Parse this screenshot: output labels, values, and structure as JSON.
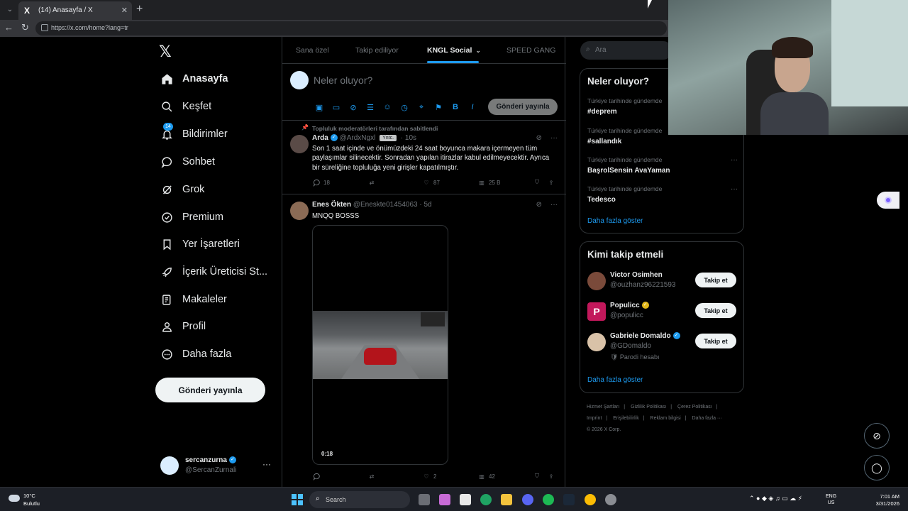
{
  "browser": {
    "tab_title": "(14) Anasayfa / X",
    "url": "https://x.com/home?lang=tr",
    "new_tab": "+",
    "close": "✕"
  },
  "nav": {
    "logo": "𝕏",
    "items": [
      {
        "label": "Anasayfa",
        "icon": "home-icon",
        "badge": ""
      },
      {
        "label": "Keşfet",
        "icon": "search-icon",
        "badge": ""
      },
      {
        "label": "Bildirimler",
        "icon": "bell-icon",
        "badge": "14"
      },
      {
        "label": "Sohbet",
        "icon": "chat-icon",
        "badge": ""
      },
      {
        "label": "Grok",
        "icon": "grok-icon",
        "badge": ""
      },
      {
        "label": "Premium",
        "icon": "premium-icon",
        "badge": ""
      },
      {
        "label": "Yer İşaretleri",
        "icon": "bookmark-icon",
        "badge": ""
      },
      {
        "label": "İçerik Üreticisi St...",
        "icon": "rocket-icon",
        "badge": ""
      },
      {
        "label": "Makaleler",
        "icon": "article-icon",
        "badge": ""
      },
      {
        "label": "Profil",
        "icon": "profile-icon",
        "badge": ""
      },
      {
        "label": "Daha fazla",
        "icon": "more-icon",
        "badge": ""
      }
    ],
    "post_button": "Gönderi yayınla",
    "profile": {
      "name": "sercanzurna",
      "handle": "@SercanZurnali",
      "more": "···"
    }
  },
  "timeline": {
    "tabs": [
      "Sana özel",
      "Takip ediliyor",
      "KNGL Social",
      "SPEED GANG"
    ],
    "active_tab": "KNGL Social",
    "compose_placeholder": "Neler oluyor?",
    "compose_post": "Gönderi yayınla",
    "posts": [
      {
        "pinned_label": "Topluluk moderatörleri tarafından sabitlendi",
        "name": "Arda",
        "handle": "@ArdxNgxl",
        "role": "Yntc.",
        "time": "· 10s",
        "text": "Son 1 saat içinde ve önümüzdeki 24 saat boyunca makara içermeyen tüm paylaşımlar silinecektir. Sonradan yapılan itirazlar kabul edilmeyecektir. Ayrıca bir süreliğine topluluğa yeni girişler kapatılmıştır.",
        "replies": "18",
        "reposts": "",
        "likes": "87",
        "views": "25 B"
      },
      {
        "name": "Enes Ökten",
        "handle": "@Eneskte01454063",
        "time": "· 5d",
        "text": "MNQQ BOSSS",
        "video_time": "0:18",
        "replies": "",
        "reposts": "",
        "likes": "2",
        "views": "42"
      }
    ]
  },
  "right": {
    "search_placeholder": "Ara",
    "trends_title": "Neler oluyor?",
    "trends": [
      {
        "context": "Türkiye tarihinde gündemde",
        "name": "#deprem"
      },
      {
        "context": "Türkiye tarihinde gündemde",
        "name": "#sallandık"
      },
      {
        "context": "Türkiye tarihinde gündemde",
        "name": "BaşrolSensin AvaYaman"
      },
      {
        "context": "Türkiye tarihinde gündemde",
        "name": "Tedesco"
      }
    ],
    "trends_more": "Daha fazla göster",
    "who_title": "Kimi takip etmeli",
    "who": [
      {
        "name": "Victor Osimhen",
        "handle": "@ouzhanz96221593",
        "extra": "",
        "verified": "",
        "avatar_color": "#7a4a3a"
      },
      {
        "name": "Populicc",
        "handle": "@populicc",
        "extra": "",
        "verified": "gold",
        "avatar_color": "#c2185b"
      },
      {
        "name": "Gabriele Domaldo",
        "handle": "@GDomaldo",
        "extra": "🛡 Parodi hesabı",
        "verified": "blue",
        "avatar_color": "#d9c2a8"
      }
    ],
    "follow_label": "Takip et",
    "who_more": "Daha fazla göster",
    "footer": [
      "Hizmet Şartları",
      "|",
      "Gizlilik Politikası",
      "|",
      "Çerez Politikası",
      "|",
      "Imprint",
      "|",
      "Erişilebilirlik",
      "|",
      "Reklam bilgisi",
      "|",
      "Daha fazla ···",
      "© 2026 X Corp."
    ]
  },
  "taskbar": {
    "temp": "10°C",
    "weather": "Bulutlu",
    "search": "Search",
    "lang_top": "ENG",
    "lang_bottom": "US",
    "time": "7:01 AM",
    "date": "3/31/2026"
  },
  "colors": {
    "accent": "#1d9bf0",
    "background": "#000000",
    "border": "#2f3336",
    "muted": "#71767b"
  }
}
